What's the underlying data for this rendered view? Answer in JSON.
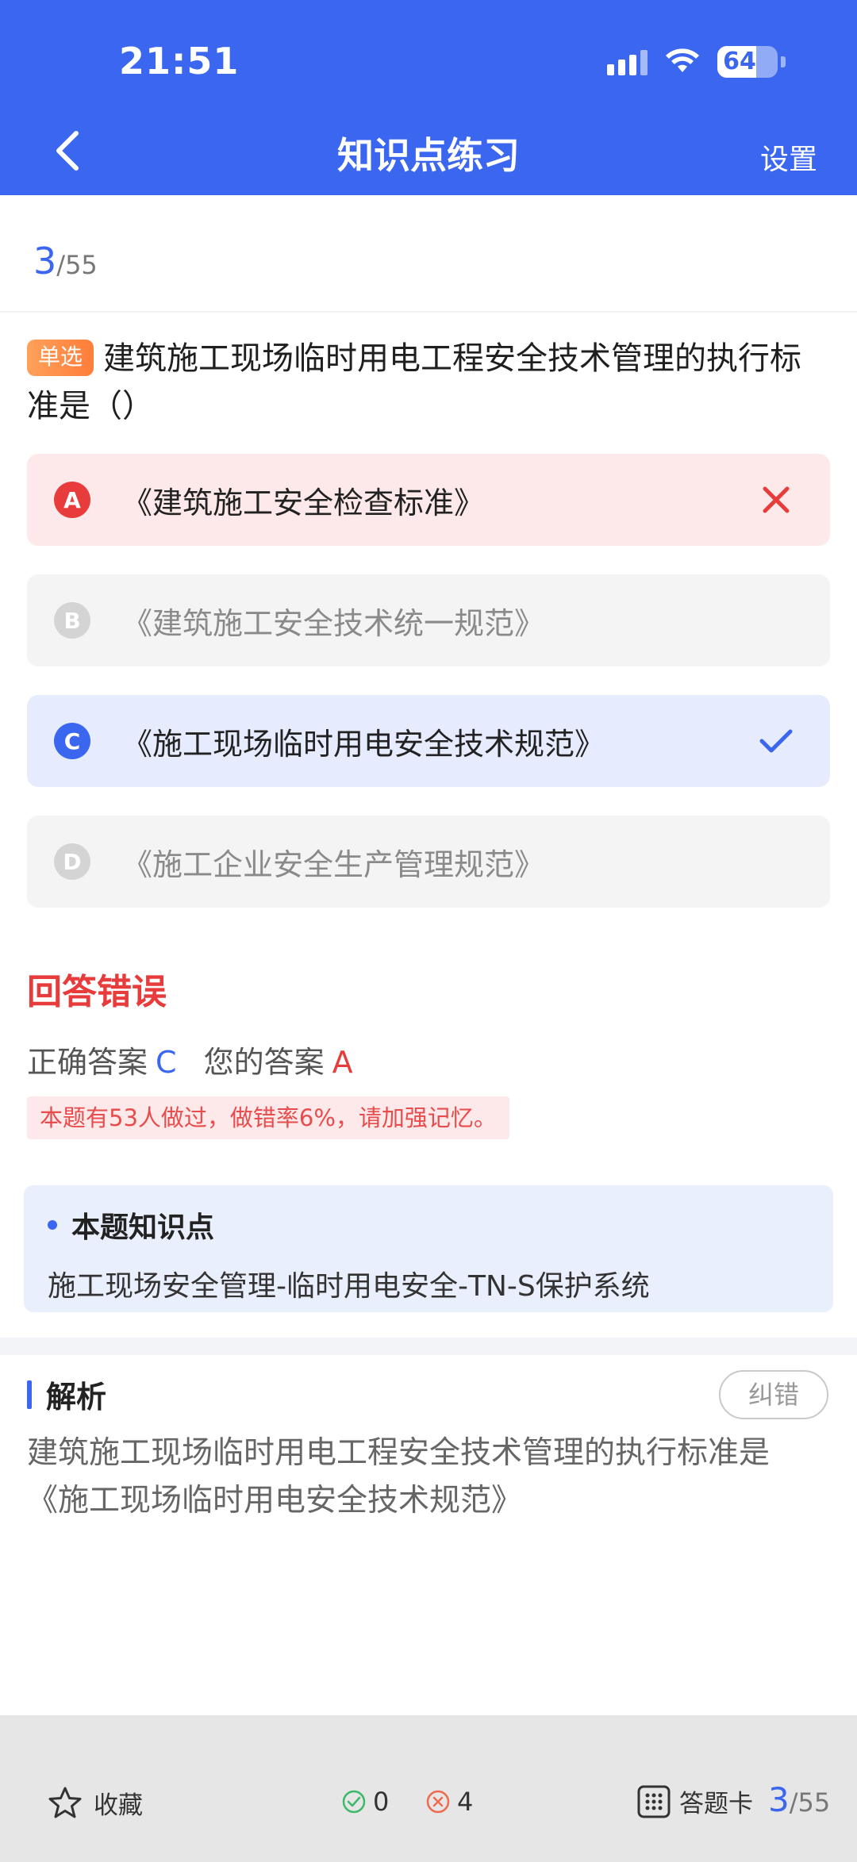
{
  "status": {
    "time": "21:51",
    "battery": "64",
    "battery_level": 0.64
  },
  "header": {
    "title": "知识点练习",
    "settings": "设置"
  },
  "progress": {
    "current": "3",
    "total": "/55"
  },
  "question": {
    "type": "单选",
    "text": "建筑施工现场临时用电工程安全技术管理的执行标准是（）"
  },
  "options": [
    {
      "letter": "A",
      "text": "《建筑施工安全检查标准》",
      "state": "wrong"
    },
    {
      "letter": "B",
      "text": "《建筑施工安全技术统一规范》",
      "state": "normal"
    },
    {
      "letter": "C",
      "text": "《施工现场临时用电安全技术规范》",
      "state": "correct"
    },
    {
      "letter": "D",
      "text": "《施工企业安全生产管理规范》",
      "state": "normal"
    }
  ],
  "result": {
    "title": "回答错误",
    "correct_label": "正确答案",
    "correct_value": "C",
    "mine_label": "您的答案",
    "mine_value": "A",
    "stat_note": "本题有53人做过，做错率6%，请加强记忆。"
  },
  "knowledge": {
    "title": "本题知识点",
    "text": "施工现场安全管理-临时用电安全-TN-S保护系统"
  },
  "analysis": {
    "title": "解析",
    "report": "纠错",
    "text": "建筑施工现场临时用电工程安全技术管理的执行标准是《施工现场临时用电安全技术规范》"
  },
  "bottom": {
    "favorite": "收藏",
    "right_count": "0",
    "wrong_count": "4",
    "answer_card": "答题卡",
    "current": "3",
    "total": "/55"
  },
  "colors": {
    "primary": "#3a66f0",
    "error": "#e83c3c",
    "tag": "#ff8a45"
  }
}
